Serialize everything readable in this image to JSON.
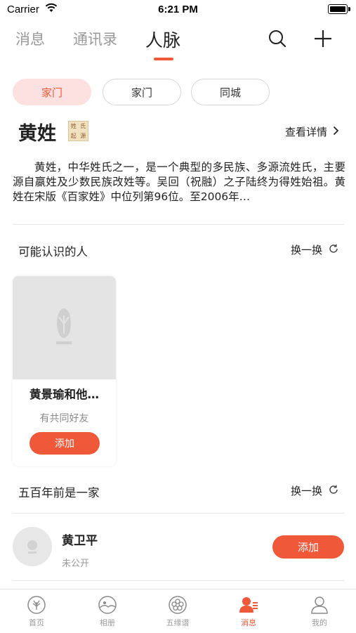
{
  "status_bar": {
    "carrier": "Carrier",
    "time": "6:21 PM"
  },
  "tabs": [
    {
      "label": "消息",
      "active": false
    },
    {
      "label": "通讯录",
      "active": false
    },
    {
      "label": "人脉",
      "active": true
    }
  ],
  "header_icons": [
    "search-icon",
    "plus-icon"
  ],
  "chips": [
    {
      "label": "家门",
      "active": true
    },
    {
      "label": "家门",
      "active": false
    },
    {
      "label": "同城",
      "active": false
    }
  ],
  "surname": {
    "title": "黄姓",
    "seal_text": [
      "姓",
      "氏",
      "起",
      "源"
    ],
    "detail_label": "查看详情",
    "description": "黄姓，中华姓氏之一，是一个典型的多民族、多源流姓氏，主要源自嬴姓及少数民族改姓等。吴回（祝融）之子陆终为得姓始祖。黄姓在宋版《百家姓》中位列第96位。至2006年…"
  },
  "people_you_may_know": {
    "title": "可能认识的人",
    "refresh_label": "换一换",
    "cards": [
      {
        "name": "黄景瑜和他…",
        "subtitle": "有共同好友",
        "button": "添加"
      }
    ]
  },
  "same_family": {
    "title": "五百年前是一家",
    "refresh_label": "换一换",
    "items": [
      {
        "name": "黄卫平",
        "subtitle": "未公开",
        "button": "添加"
      }
    ]
  },
  "bottom_nav": [
    {
      "label": "首页",
      "icon": "hand-icon",
      "active": false
    },
    {
      "label": "相册",
      "icon": "album-icon",
      "active": false
    },
    {
      "label": "五缘谱",
      "icon": "flower-icon",
      "active": false
    },
    {
      "label": "消息",
      "icon": "contacts-icon",
      "active": true
    },
    {
      "label": "我的",
      "icon": "user-icon",
      "active": false
    }
  ],
  "colors": {
    "accent": "#f0583a",
    "chip_active_bg": "#fde1e1",
    "placeholder_gray": "#e4e4e4"
  }
}
